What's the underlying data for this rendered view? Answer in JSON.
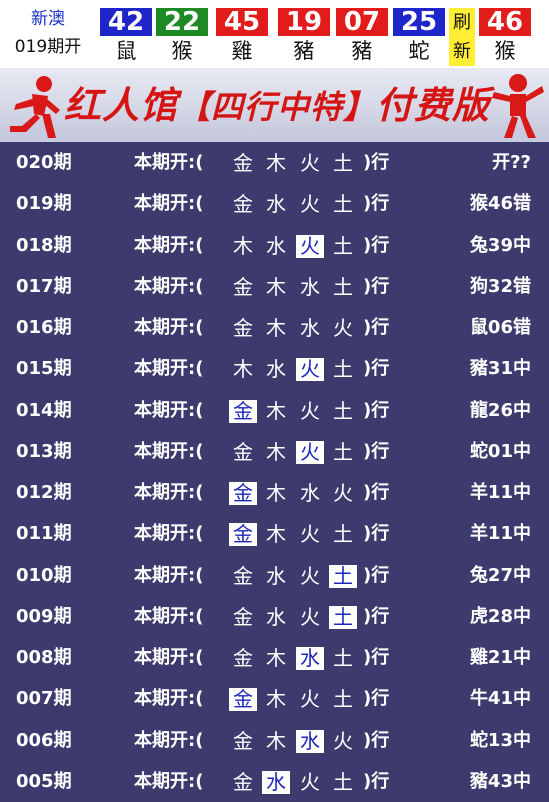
{
  "header": {
    "label_line1": "新澳",
    "label_line2": "019期开",
    "balls": [
      {
        "number": "42",
        "zodiac": "鼠",
        "color": "#1e25c9"
      },
      {
        "number": "22",
        "zodiac": "猴",
        "color": "#1e8a26"
      },
      {
        "number": "45",
        "zodiac": "雞",
        "color": "#e21b1b"
      },
      {
        "number": "19",
        "zodiac": "豬",
        "color": "#e21b1b"
      },
      {
        "number": "07",
        "zodiac": "豬",
        "color": "#e21b1b"
      },
      {
        "number": "25",
        "zodiac": "蛇",
        "color": "#1e25c9"
      }
    ],
    "special_top": "刷",
    "special_bottom": "新",
    "special_ball": {
      "number": "46",
      "zodiac": "猴",
      "color": "#e21b1b"
    }
  },
  "banner": {
    "title_left": "红人馆",
    "title_mid": "【四行中特】",
    "title_right": "付费版"
  },
  "rows": [
    {
      "issue": "020期",
      "prefix": "本期开:(",
      "elements": [
        "金",
        "木",
        "火",
        "土"
      ],
      "highlight": -1,
      "suffix": ")行",
      "result": "开??"
    },
    {
      "issue": "019期",
      "prefix": "本期开:(",
      "elements": [
        "金",
        "水",
        "火",
        "土"
      ],
      "highlight": -1,
      "suffix": ")行",
      "result": "猴46错"
    },
    {
      "issue": "018期",
      "prefix": "本期开:(",
      "elements": [
        "木",
        "水",
        "火",
        "土"
      ],
      "highlight": 2,
      "suffix": ")行",
      "result": "兔39中"
    },
    {
      "issue": "017期",
      "prefix": "本期开:(",
      "elements": [
        "金",
        "木",
        "水",
        "土"
      ],
      "highlight": -1,
      "suffix": ")行",
      "result": "狗32错"
    },
    {
      "issue": "016期",
      "prefix": "本期开:(",
      "elements": [
        "金",
        "木",
        "水",
        "火"
      ],
      "highlight": -1,
      "suffix": ")行",
      "result": "鼠06错"
    },
    {
      "issue": "015期",
      "prefix": "本期开:(",
      "elements": [
        "木",
        "水",
        "火",
        "土"
      ],
      "highlight": 2,
      "suffix": ")行",
      "result": "豬31中"
    },
    {
      "issue": "014期",
      "prefix": "本期开:(",
      "elements": [
        "金",
        "木",
        "火",
        "土"
      ],
      "highlight": 0,
      "suffix": ")行",
      "result": "龍26中"
    },
    {
      "issue": "013期",
      "prefix": "本期开:(",
      "elements": [
        "金",
        "木",
        "火",
        "土"
      ],
      "highlight": 2,
      "suffix": ")行",
      "result": "蛇01中"
    },
    {
      "issue": "012期",
      "prefix": "本期开:(",
      "elements": [
        "金",
        "木",
        "水",
        "火"
      ],
      "highlight": 0,
      "suffix": ")行",
      "result": "羊11中"
    },
    {
      "issue": "011期",
      "prefix": "本期开:(",
      "elements": [
        "金",
        "木",
        "火",
        "土"
      ],
      "highlight": 0,
      "suffix": ")行",
      "result": "羊11中"
    },
    {
      "issue": "010期",
      "prefix": "本期开:(",
      "elements": [
        "金",
        "水",
        "火",
        "土"
      ],
      "highlight": 3,
      "suffix": ")行",
      "result": "兔27中"
    },
    {
      "issue": "009期",
      "prefix": "本期开:(",
      "elements": [
        "金",
        "水",
        "火",
        "土"
      ],
      "highlight": 3,
      "suffix": ")行",
      "result": "虎28中"
    },
    {
      "issue": "008期",
      "prefix": "本期开:(",
      "elements": [
        "金",
        "木",
        "水",
        "土"
      ],
      "highlight": 2,
      "suffix": ")行",
      "result": "雞21中"
    },
    {
      "issue": "007期",
      "prefix": "本期开:(",
      "elements": [
        "金",
        "木",
        "火",
        "土"
      ],
      "highlight": 0,
      "suffix": ")行",
      "result": "牛41中"
    },
    {
      "issue": "006期",
      "prefix": "本期开:(",
      "elements": [
        "金",
        "木",
        "水",
        "火"
      ],
      "highlight": 2,
      "suffix": ")行",
      "result": "蛇13中"
    },
    {
      "issue": "005期",
      "prefix": "本期开:(",
      "elements": [
        "金",
        "水",
        "火",
        "土"
      ],
      "highlight": 1,
      "suffix": ")行",
      "result": "豬43中"
    }
  ]
}
